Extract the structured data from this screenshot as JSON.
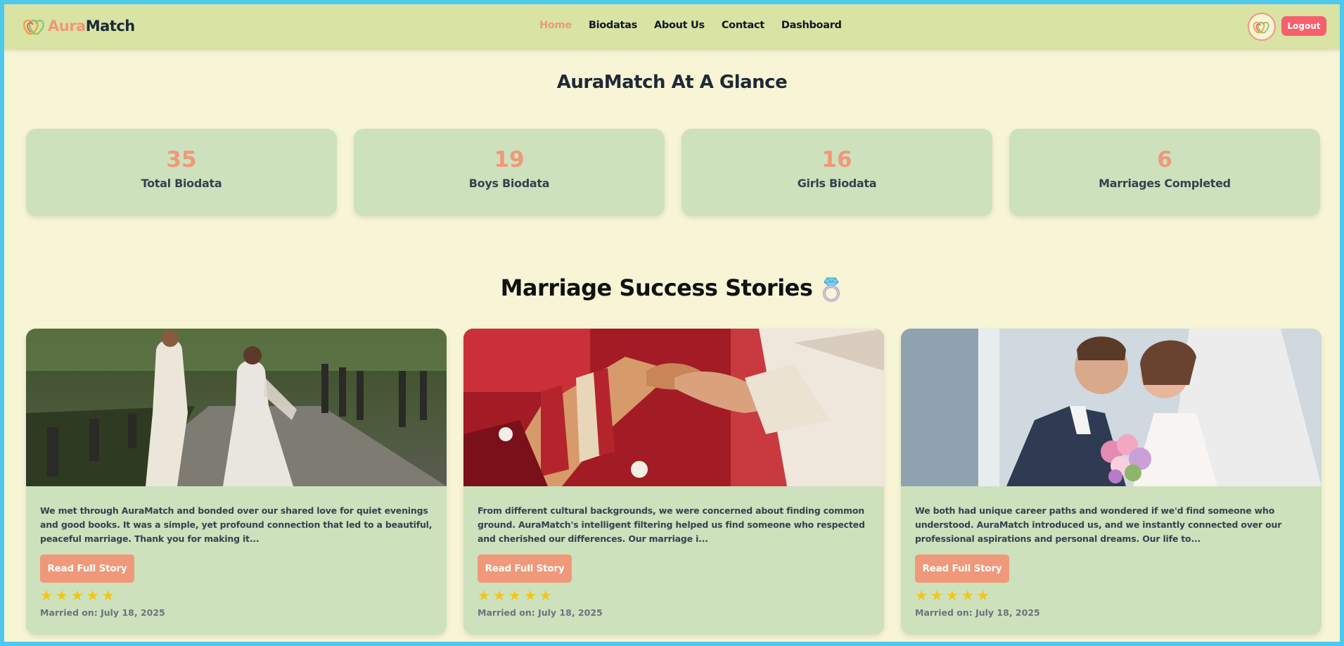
{
  "brand": {
    "name_part1": "Aura",
    "name_part2": "Match"
  },
  "nav": {
    "items": [
      {
        "label": "Home",
        "active": true
      },
      {
        "label": "Biodatas",
        "active": false
      },
      {
        "label": "About Us",
        "active": false
      },
      {
        "label": "Contact",
        "active": false
      },
      {
        "label": "Dashboard",
        "active": false
      }
    ],
    "logout_label": "Logout"
  },
  "glance": {
    "title": "AuraMatch At A Glance",
    "stats": [
      {
        "value": "35",
        "label": "Total Biodata"
      },
      {
        "value": "19",
        "label": "Boys Biodata"
      },
      {
        "value": "16",
        "label": "Girls Biodata"
      },
      {
        "value": "6",
        "label": "Marriages Completed"
      }
    ]
  },
  "stories": {
    "title": "Marriage Success Stories",
    "title_icon": "ring-icon",
    "items": [
      {
        "text": "We met through AuraMatch and bonded over our shared love for quiet evenings and good books. It was a simple, yet profound connection that led to a beautiful, peaceful marriage. Thank you for making it...",
        "button": "Read Full Story",
        "rating": 5,
        "married_on": "Married on: July 18, 2025"
      },
      {
        "text": "From different cultural backgrounds, we were concerned about finding common ground. AuraMatch's intelligent filtering helped us find someone who respected and cherished our differences. Our marriage i...",
        "button": "Read Full Story",
        "rating": 5,
        "married_on": "Married on: July 18, 2025"
      },
      {
        "text": "We both had unique career paths and wondered if we'd find someone who understood. AuraMatch introduced us, and we instantly connected over our professional aspirations and personal dreams. Our life to...",
        "button": "Read Full Story",
        "rating": 5,
        "married_on": "Married on: July 18, 2025"
      }
    ]
  },
  "colors": {
    "accent": "#f0987a",
    "navbar": "#d8e3a4",
    "page_bg": "#f8f5d6",
    "card_bg": "#cde1bd",
    "logout": "#f6606d",
    "star": "#f7c415"
  }
}
